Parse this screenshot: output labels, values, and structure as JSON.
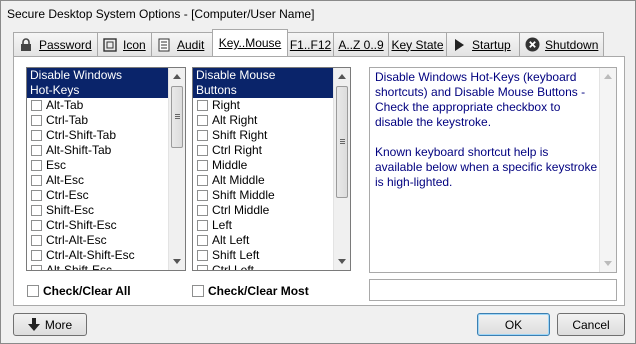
{
  "window": {
    "title": "Secure Desktop System Options - [Computer/User Name]"
  },
  "tabs": [
    {
      "label": "Password",
      "icon": "lock-icon"
    },
    {
      "label": "Icon",
      "icon": "icon-frame-icon"
    },
    {
      "label": "Audit",
      "icon": "document-icon"
    },
    {
      "label": "Key..Mouse",
      "icon": "",
      "active": true
    },
    {
      "label": "F1..F12",
      "icon": ""
    },
    {
      "label": "A..Z  0..9",
      "icon": ""
    },
    {
      "label": "Key State",
      "icon": ""
    },
    {
      "label": "Startup",
      "icon": "play-icon"
    },
    {
      "label": "Shutdown",
      "icon": "close-circle-icon"
    }
  ],
  "hotkeys": {
    "header1": "Disable Windows",
    "header2": "Hot-Keys",
    "items": [
      "Alt-Tab",
      "Ctrl-Tab",
      "Ctrl-Shift-Tab",
      "Alt-Shift-Tab",
      "Esc",
      "Alt-Esc",
      "Ctrl-Esc",
      "Shift-Esc",
      "Ctrl-Shift-Esc",
      "Ctrl-Alt-Esc",
      "Ctrl-Alt-Shift-Esc",
      "Alt-Shift-Esc"
    ],
    "check_all_label": "Check/Clear All"
  },
  "mouse": {
    "header1": "Disable Mouse",
    "header2": "Buttons",
    "items": [
      "Right",
      "Alt Right",
      "Shift Right",
      "Ctrl Right",
      "Middle",
      "Alt Middle",
      "Shift Middle",
      "Ctrl Middle",
      "Left",
      "Alt Left",
      "Shift Left",
      "Ctrl Left"
    ],
    "check_most_label": "Check/Clear Most"
  },
  "help": {
    "text": "Disable Windows Hot-Keys (keyboard\nshortcuts) and Disable Mouse Buttons -\nCheck the appropriate checkbox to\ndisable the keystroke.\n\nKnown keyboard shortcut help is\navailable below when a specific keystroke\nis high-lighted.",
    "shortcut_help": ""
  },
  "buttons": {
    "more": "More",
    "ok": "OK",
    "cancel": "Cancel"
  },
  "colors": {
    "selection": "#0a246a",
    "help_text": "#00007f"
  }
}
